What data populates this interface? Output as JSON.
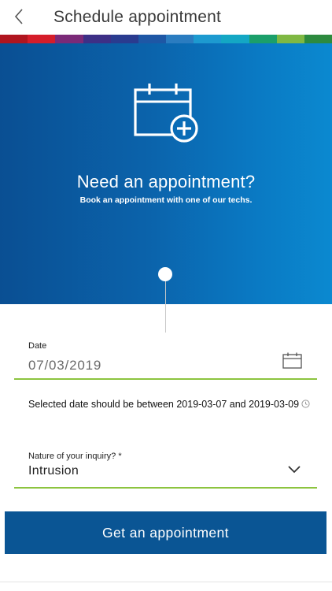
{
  "header": {
    "title": "Schedule appointment",
    "back_icon": "chevron-left-icon"
  },
  "brand_stripe": {
    "colors": [
      "#b0151f",
      "#d51d2a",
      "#7b2a78",
      "#3d2f86",
      "#2a3b8f",
      "#1e57a5",
      "#2b7cc0",
      "#1d9ad0",
      "#14a7c4",
      "#1b9f6a",
      "#7fb843",
      "#2d8a3e"
    ]
  },
  "hero": {
    "icon": "calendar-add-icon",
    "title": "Need an appointment?",
    "subtitle": "Book an appointment with one of our techs.",
    "gradient_start": "#0a4f93",
    "gradient_end": "#0b89d0"
  },
  "form": {
    "date": {
      "label": "Date",
      "value": "07/03/2019",
      "icon": "calendar-icon"
    },
    "hint": {
      "text": "Selected date should be between 2019-03-07 and 2019-03-09",
      "icon": "clock-icon"
    },
    "inquiry": {
      "label": "Nature of your inquiry? *",
      "selected": "Intrusion",
      "icon": "chevron-down-icon"
    },
    "accent_color": "#8cc43f"
  },
  "submit": {
    "label": "Get an appointment",
    "color": "#0a5594"
  }
}
